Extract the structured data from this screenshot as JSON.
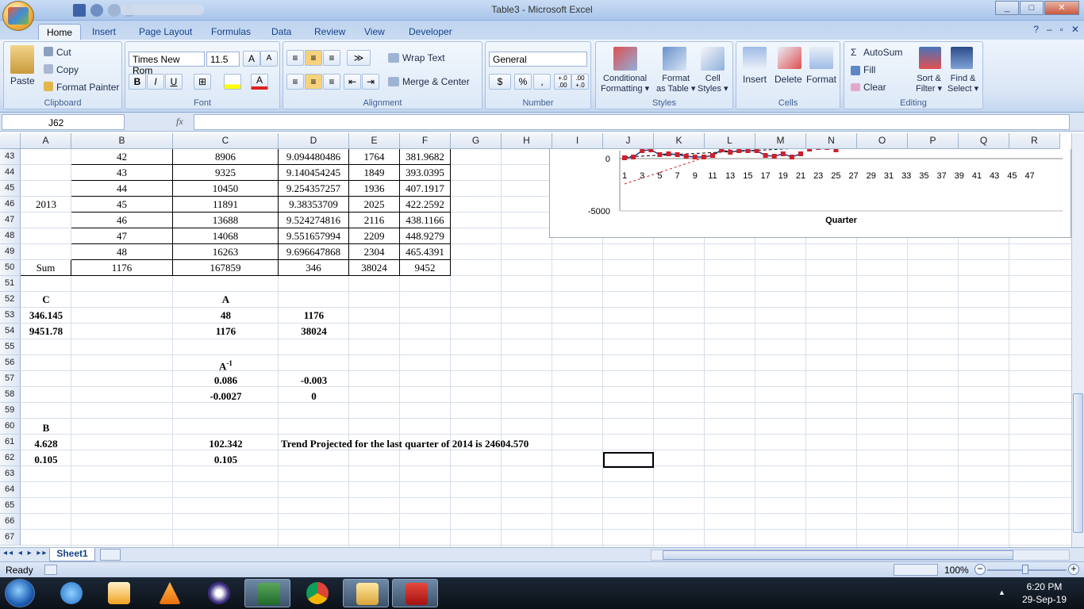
{
  "window": {
    "title": "Table3 - Microsoft Excel"
  },
  "tabs": [
    "Home",
    "Insert",
    "Page Layout",
    "Formulas",
    "Data",
    "Review",
    "View",
    "Developer"
  ],
  "clipboard": {
    "paste": "Paste",
    "cut": "Cut",
    "copy": "Copy",
    "format_painter": "Format Painter",
    "label": "Clipboard"
  },
  "font": {
    "name": "Times New Rom",
    "size": "11.5",
    "bold": "B",
    "italic": "I",
    "underline": "U",
    "grow": "A",
    "shrink": "A",
    "label": "Font"
  },
  "alignment": {
    "wrap": "Wrap Text",
    "merge": "Merge & Center",
    "label": "Alignment"
  },
  "number": {
    "format": "General",
    "currency": "$",
    "percent": "%",
    "comma": ",",
    "inc": "+.0\n.00",
    "dec": ".00\n+.0",
    "label": "Number"
  },
  "styles": {
    "conditional": "Conditional\nFormatting",
    "as_table": "Format\nas Table",
    "cell_styles": "Cell\nStyles",
    "label": "Styles"
  },
  "cells_grp": {
    "insert": "Insert",
    "delete": "Delete",
    "format": "Format",
    "label": "Cells"
  },
  "editing": {
    "autosum": "AutoSum",
    "fill": "Fill",
    "clear": "Clear",
    "sort": "Sort &\nFilter",
    "find": "Find &\nSelect",
    "label": "Editing"
  },
  "namebox": "J62",
  "fx": "fx",
  "columns": [
    "A",
    "B",
    "C",
    "D",
    "E",
    "F",
    "G",
    "H",
    "I",
    "J",
    "K",
    "L",
    "M",
    "N",
    "O",
    "P",
    "Q",
    "R"
  ],
  "rows": [
    "43",
    "44",
    "45",
    "46",
    "47",
    "48",
    "49",
    "50",
    "51",
    "52",
    "53",
    "54",
    "55",
    "56",
    "57",
    "58",
    "59",
    "60",
    "61",
    "62",
    "63",
    "64",
    "65",
    "66",
    "67"
  ],
  "table_rows": [
    {
      "a": "",
      "b": "42",
      "c": "8906",
      "d": "9.094480486",
      "e": "1764",
      "f": "381.9682"
    },
    {
      "a": "",
      "b": "43",
      "c": "9325",
      "d": "9.140454245",
      "e": "1849",
      "f": "393.0395"
    },
    {
      "a": "",
      "b": "44",
      "c": "10450",
      "d": "9.254357257",
      "e": "1936",
      "f": "407.1917"
    },
    {
      "a": "2013",
      "b": "45",
      "c": "11891",
      "d": "9.38353709",
      "e": "2025",
      "f": "422.2592"
    },
    {
      "a": "",
      "b": "46",
      "c": "13688",
      "d": "9.524274816",
      "e": "2116",
      "f": "438.1166"
    },
    {
      "a": "",
      "b": "47",
      "c": "14068",
      "d": "9.551657994",
      "e": "2209",
      "f": "448.9279"
    },
    {
      "a": "",
      "b": "48",
      "c": "16263",
      "d": "9.696647868",
      "e": "2304",
      "f": "465.4391"
    },
    {
      "a": "Sum",
      "b": "1176",
      "c": "167859",
      "d": "346",
      "e": "38024",
      "f": "9452"
    }
  ],
  "calc": {
    "c_label": "C",
    "c1": "346.145",
    "c2": "9451.78",
    "a_label": "A",
    "a11": "48",
    "a12": "1176",
    "a21": "1176",
    "a22": "38024",
    "ainv_label": "A",
    "ainv_sup": "-1",
    "ai11": "0.086",
    "ai12": "-0.003",
    "ai21": "-0.0027",
    "ai22": "0",
    "b_label": "B",
    "b1": "4.628",
    "b2": "0.105",
    "r1": "102.342",
    "r2": "0.105",
    "trend": "Trend Projected for the last quarter of 2014 is 24604.570"
  },
  "chart_data": {
    "type": "line",
    "xlabel": "Quarter",
    "x_ticks": [
      "1",
      "3",
      "5",
      "7",
      "9",
      "11",
      "13",
      "15",
      "17",
      "19",
      "21",
      "23",
      "25",
      "27",
      "29",
      "31",
      "33",
      "35",
      "37",
      "39",
      "41",
      "43",
      "45",
      "47"
    ],
    "y_ticks": [
      "0",
      "-5000"
    ],
    "colors": {
      "series": "#1f3f8f",
      "markers": "#d0202a",
      "trend": "#d0202a"
    }
  },
  "sheet": {
    "tab": "Sheet1"
  },
  "status": {
    "ready": "Ready",
    "zoom": "100%"
  },
  "clock": {
    "time": "6:20 PM",
    "date": "29-Sep-19"
  }
}
